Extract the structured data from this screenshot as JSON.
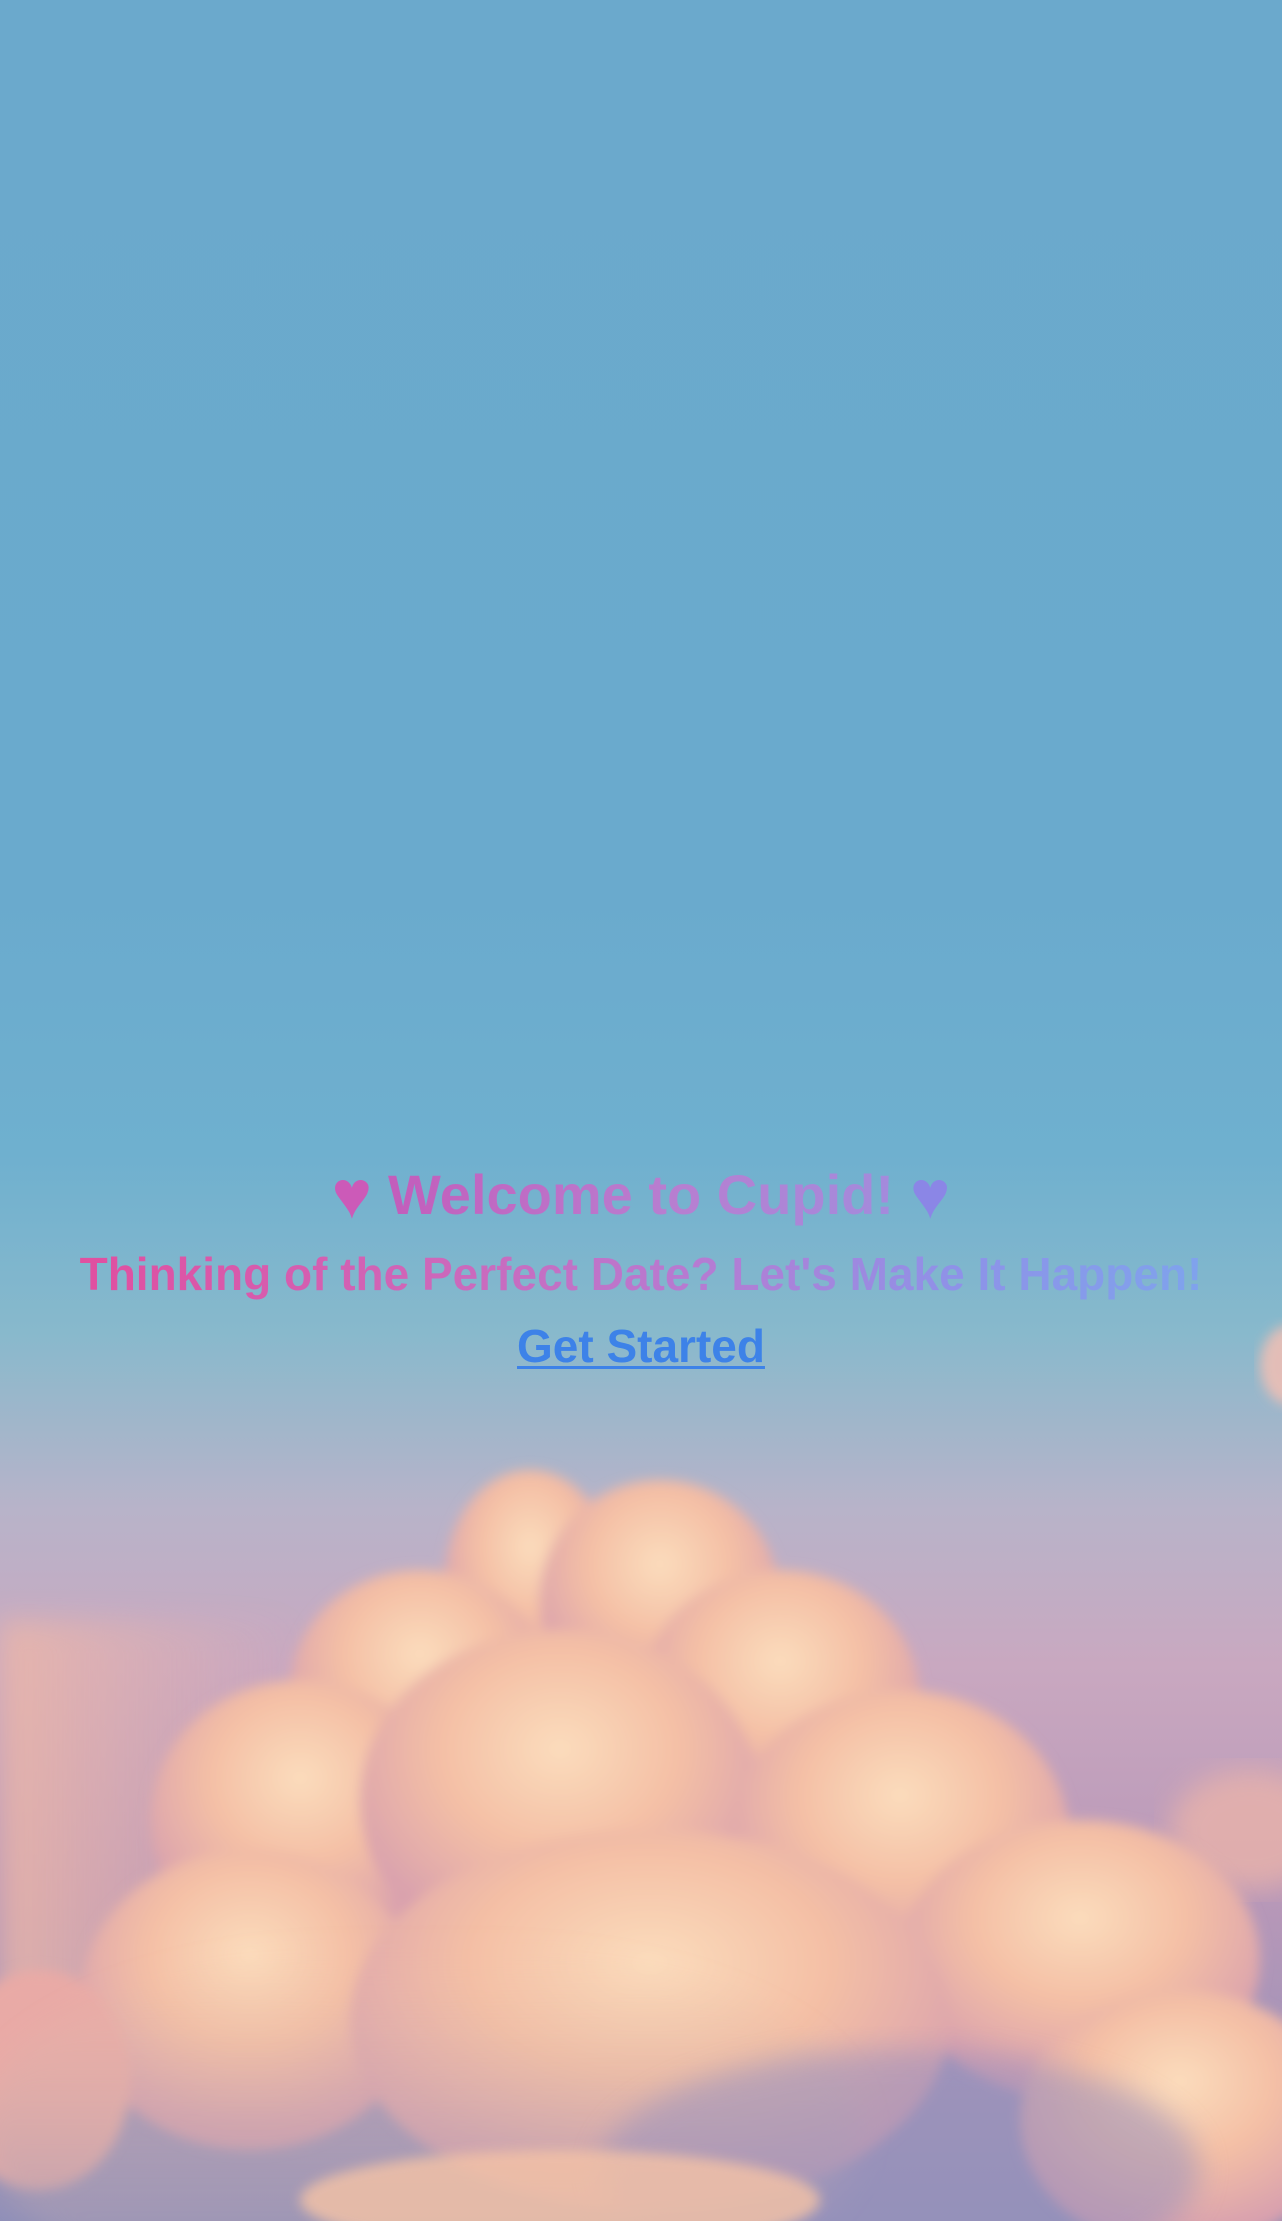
{
  "hero": {
    "heart_left": "♥",
    "title": "Welcome to Cupid!",
    "heart_right": "♥",
    "tagline": "Thinking of the Perfect Date? Let's Make It Happen!",
    "cta_label": "Get Started"
  },
  "colors": {
    "sky": "#6aaacd",
    "cloud": "#f6c5a6",
    "heart_pink": "#cc5ab8",
    "heart_purple": "#8b86e6",
    "link": "#3d82e8"
  }
}
